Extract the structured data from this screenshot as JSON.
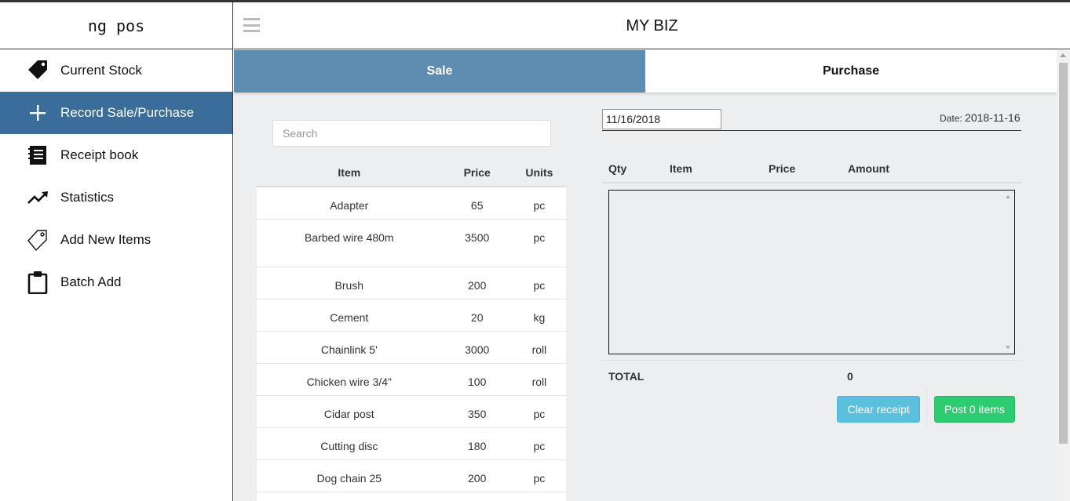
{
  "brand": "ng pos",
  "app_title": "MY BIZ",
  "sidebar": {
    "items": [
      {
        "label": "Current Stock",
        "icon": "tag-icon"
      },
      {
        "label": "Record Sale/Purchase",
        "icon": "plus-icon",
        "active": true
      },
      {
        "label": "Receipt book",
        "icon": "book-icon"
      },
      {
        "label": "Statistics",
        "icon": "trending-up-icon"
      },
      {
        "label": "Add New Items",
        "icon": "tag-outline-icon"
      },
      {
        "label": "Batch Add",
        "icon": "clipboard-icon"
      }
    ]
  },
  "tabs": [
    {
      "label": "Sale",
      "active": true
    },
    {
      "label": "Purchase",
      "active": false
    }
  ],
  "search": {
    "placeholder": "Search"
  },
  "items_table": {
    "headers": [
      "Item",
      "Price",
      "Units"
    ],
    "rows": [
      {
        "item": "Adapter",
        "price": "65",
        "units": "pc"
      },
      {
        "item": "Barbed wire 480m",
        "price": "3500",
        "units": "pc"
      },
      {
        "item": "Brush",
        "price": "200",
        "units": "pc"
      },
      {
        "item": "Cement",
        "price": "20",
        "units": "kg"
      },
      {
        "item": "Chainlink 5'",
        "price": "3000",
        "units": "roll"
      },
      {
        "item": "Chicken wire 3/4\"",
        "price": "100",
        "units": "roll"
      },
      {
        "item": "Cidar post",
        "price": "350",
        "units": "pc"
      },
      {
        "item": "Cutting disc",
        "price": "180",
        "units": "pc"
      },
      {
        "item": "Dog chain 25",
        "price": "200",
        "units": "pc"
      }
    ]
  },
  "receipt": {
    "date_input": "11/16/2018",
    "date_label": "Date:",
    "date_value": "2018-11-16",
    "headers": {
      "qty": "Qty",
      "item": "Item",
      "price": "Price",
      "amount": "Amount"
    },
    "total_label": "TOTAL",
    "total_value": "0",
    "clear_label": "Clear receipt",
    "post_label": "Post 0 items"
  },
  "colors": {
    "sidebar_active": "#3a6d9a",
    "tab_active": "#5f8cb1",
    "clear_button": "#5bc0de",
    "post_button": "#2ecc71",
    "main_bg": "#eceeef"
  }
}
